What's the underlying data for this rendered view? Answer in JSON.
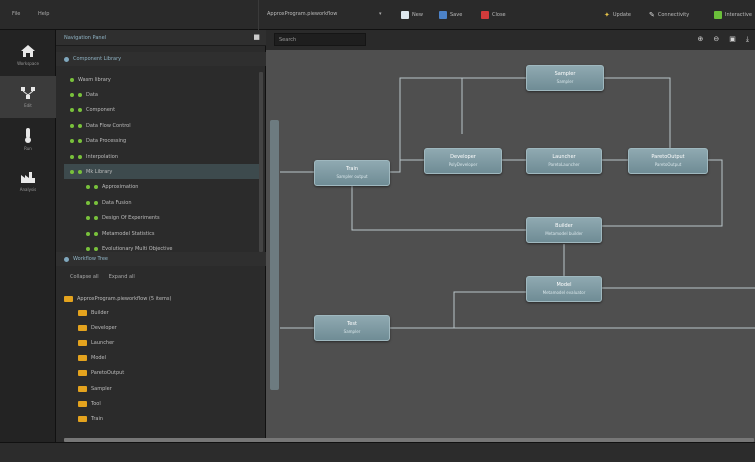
{
  "menu": {
    "file": "File",
    "help": "Help"
  },
  "toolbar": {
    "document_title": "ApproxProgram.pieworkflow",
    "new_label": "New",
    "save_label": "Save",
    "close_label": "Close",
    "rename_label": "Update",
    "connectivity_label": "Connectivity",
    "extra_label": "Interactive"
  },
  "rail": [
    {
      "name": "workspace",
      "label": "Workspace"
    },
    {
      "name": "edit",
      "label": "Edit"
    },
    {
      "name": "run",
      "label": "Run"
    },
    {
      "name": "analysis",
      "label": "Analysis"
    }
  ],
  "navigation": {
    "title": "Navigation Panel",
    "component_library": "Component Library",
    "library_items": [
      "Wasm library",
      "Data",
      "Component",
      "Data Flow Control",
      "Data Processing",
      "Interpolation",
      "Mk Library",
      "Approximation",
      "Data Fusion",
      "Design Of Experiments",
      "Metamodel Statistics",
      "Evolutionary Multi Objective"
    ],
    "workflow_tree": "Workflow Tree",
    "collapse_all": "Collapse all",
    "expand_all": "Expand all",
    "workflow_root": "ApproxProgram.pieworkflow (5 items)",
    "workflow_folders": [
      "Builder",
      "Developer",
      "Launcher",
      "Model",
      "ParetoOutput",
      "Sampler",
      "Tool",
      "Train"
    ]
  },
  "canvas": {
    "search_placeholder": "Search",
    "nodes": [
      {
        "id": "sampler",
        "title": "Sampler",
        "sub": "Sampler"
      },
      {
        "id": "train",
        "title": "Train",
        "sub": "Sampler output"
      },
      {
        "id": "developer",
        "title": "Developer",
        "sub": "PolyDeveloper"
      },
      {
        "id": "launcher",
        "title": "Launcher",
        "sub": "ParetoLauncher"
      },
      {
        "id": "pareto",
        "title": "ParetoOutput",
        "sub": "ParetoOutput"
      },
      {
        "id": "builder",
        "title": "Builder",
        "sub": "Metamodel builder"
      },
      {
        "id": "model",
        "title": "Model",
        "sub": "Metamodel evaluator"
      },
      {
        "id": "test",
        "title": "Test",
        "sub": "Sampler"
      }
    ]
  },
  "colors": {
    "accent": "#8fb3c4",
    "node": "#7f9ba3",
    "folder": "#e4a31e",
    "tree_dot": "#79c13b"
  }
}
